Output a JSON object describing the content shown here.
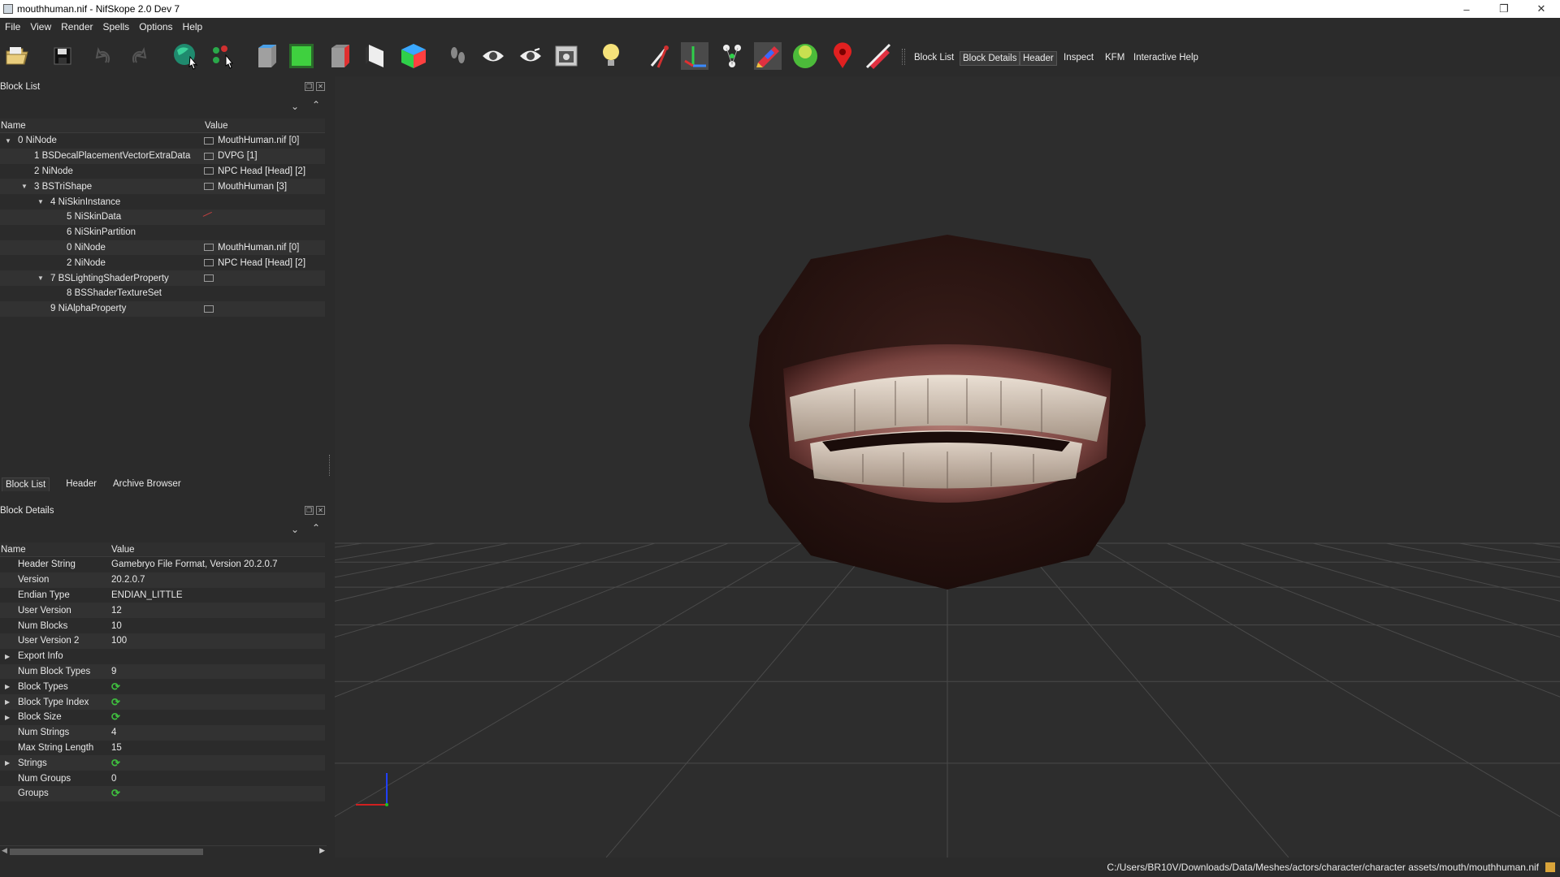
{
  "window": {
    "title": "mouthhuman.nif - NifSkope 2.0 Dev 7",
    "minimize": "–",
    "restore": "❐",
    "close": "✕"
  },
  "menu": [
    "File",
    "View",
    "Render",
    "Spells",
    "Options",
    "Help"
  ],
  "toolbar": {
    "icons": [
      "open-folder-icon",
      "save-disk-icon",
      "undo-icon",
      "redo-icon",
      "select-globe-icon",
      "select-nodes-icon",
      "view-front-icon",
      "view-top-icon",
      "view-side-icon",
      "view-flip-icon",
      "view-user-icon",
      "walk-icon",
      "eye-icon",
      "eye-flip-icon",
      "screenshot-icon",
      "light-bulb-icon",
      "pin-icon",
      "axes-icon",
      "node-graph-icon",
      "texture-pencil-icon",
      "lighting-sphere-icon",
      "marker-icon",
      "vertex-off-icon"
    ],
    "text_buttons": [
      "Block List",
      "Block Details",
      "Header",
      "Inspect",
      "KFM",
      "Interactive Help"
    ]
  },
  "block_list": {
    "title": "Block List",
    "columns": [
      "Name",
      "Value"
    ],
    "rows": [
      {
        "name": "0 NiNode",
        "value": "MouthHuman.nif [0]",
        "indent": 0,
        "expander": "▼",
        "link": true
      },
      {
        "name": "1 BSDecalPlacementVectorExtraData",
        "value": "DVPG [1]",
        "indent": 1,
        "expander": "",
        "link": true
      },
      {
        "name": "2 NiNode",
        "value": "NPC Head [Head] [2]",
        "indent": 1,
        "expander": "",
        "link": true
      },
      {
        "name": "3 BSTriShape",
        "value": "MouthHuman [3]",
        "indent": 1,
        "expander": "▼",
        "link": true
      },
      {
        "name": "4 NiSkinInstance",
        "value": "",
        "indent": 2,
        "expander": "▼",
        "link": false
      },
      {
        "name": "5 NiSkinData",
        "value": "",
        "indent": 3,
        "expander": "",
        "link": false,
        "linkglyph": true
      },
      {
        "name": "6 NiSkinPartition",
        "value": "",
        "indent": 3,
        "expander": "",
        "link": false
      },
      {
        "name": "0 NiNode",
        "value": "MouthHuman.nif [0]",
        "indent": 3,
        "expander": "",
        "link": true
      },
      {
        "name": "2 NiNode",
        "value": "NPC Head [Head] [2]",
        "indent": 3,
        "expander": "",
        "link": true
      },
      {
        "name": "7 BSLightingShaderProperty",
        "value": "",
        "indent": 2,
        "expander": "▼",
        "link": true
      },
      {
        "name": "8 BSShaderTextureSet",
        "value": "",
        "indent": 3,
        "expander": "",
        "link": false
      },
      {
        "name": "9 NiAlphaProperty",
        "value": "",
        "indent": 2,
        "expander": "",
        "link": true
      }
    ]
  },
  "tabs": [
    "Block List",
    "Header",
    "Archive Browser"
  ],
  "block_details": {
    "title": "Block Details",
    "columns": [
      "Name",
      "Value"
    ],
    "rows": [
      {
        "name": "Header String",
        "value": "Gamebryo File Format, Version 20.2.0.7",
        "expander": ""
      },
      {
        "name": "Version",
        "value": "20.2.0.7",
        "expander": ""
      },
      {
        "name": "Endian Type",
        "value": "ENDIAN_LITTLE",
        "expander": ""
      },
      {
        "name": "User Version",
        "value": "12",
        "expander": ""
      },
      {
        "name": "Num Blocks",
        "value": "10",
        "expander": ""
      },
      {
        "name": "User Version 2",
        "value": "100",
        "expander": ""
      },
      {
        "name": "Export Info",
        "value": "",
        "expander": "▶"
      },
      {
        "name": "Num Block Types",
        "value": "9",
        "expander": ""
      },
      {
        "name": "Block Types",
        "value": "",
        "expander": "▶",
        "refresh": true
      },
      {
        "name": "Block Type Index",
        "value": "",
        "expander": "▶",
        "refresh": true
      },
      {
        "name": "Block Size",
        "value": "",
        "expander": "▶",
        "refresh": true
      },
      {
        "name": "Num Strings",
        "value": "4",
        "expander": ""
      },
      {
        "name": "Max String Length",
        "value": "15",
        "expander": ""
      },
      {
        "name": "Strings",
        "value": "",
        "expander": "▶",
        "refresh": true
      },
      {
        "name": "Num Groups",
        "value": "0",
        "expander": ""
      },
      {
        "name": "Groups",
        "value": "",
        "expander": "",
        "refresh": true
      }
    ]
  },
  "status": {
    "path": "C:/Users/BR10V/Downloads/Data/Meshes/actors/character/character assets/mouth/mouthhuman.nif"
  },
  "colors": {
    "background": "#2b2b2b",
    "viewport": "#2d2d2d",
    "grid": "#4a4a4a",
    "axis_x": "#d02020",
    "axis_z": "#2040ff"
  }
}
